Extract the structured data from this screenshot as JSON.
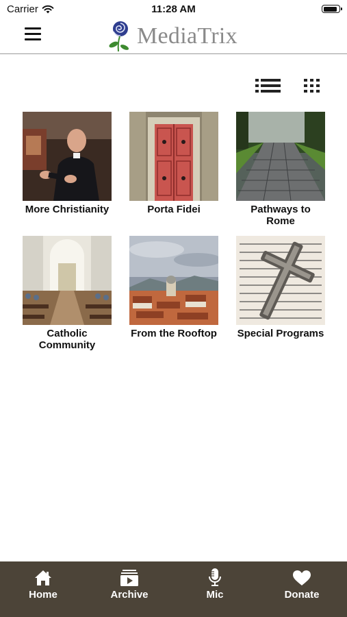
{
  "status_bar": {
    "carrier": "Carrier",
    "time": "11:28 AM",
    "battery_level": 0.9
  },
  "header": {
    "app_name": "MediaTrix",
    "menu_icon": "hamburger-menu-icon",
    "logo_icon": "rose-icon"
  },
  "view_toggles": {
    "list_icon": "list-view-icon",
    "grid_icon": "grid-view-icon"
  },
  "programs": [
    {
      "title": "More Christianity",
      "image": "priest-speaking"
    },
    {
      "title": "Porta Fidei",
      "image": "red-door"
    },
    {
      "title": "Pathways to Rome",
      "image": "cobblestone-road"
    },
    {
      "title": "Catholic Community",
      "image": "church-interior"
    },
    {
      "title": "From the Rooftop",
      "image": "rooftops-city"
    },
    {
      "title": "Special Programs",
      "image": "crucifix-on-book"
    }
  ],
  "tabs": [
    {
      "label": "Home",
      "icon": "home-icon"
    },
    {
      "label": "Archive",
      "icon": "archive-play-icon"
    },
    {
      "label": "Mic",
      "icon": "microphone-icon"
    },
    {
      "label": "Donate",
      "icon": "heart-icon"
    }
  ],
  "colors": {
    "tab_bar": "#4c4438",
    "logo_text": "#8a8a8a",
    "rose": "#2f3e8f",
    "leaf": "#3d8a2f"
  }
}
